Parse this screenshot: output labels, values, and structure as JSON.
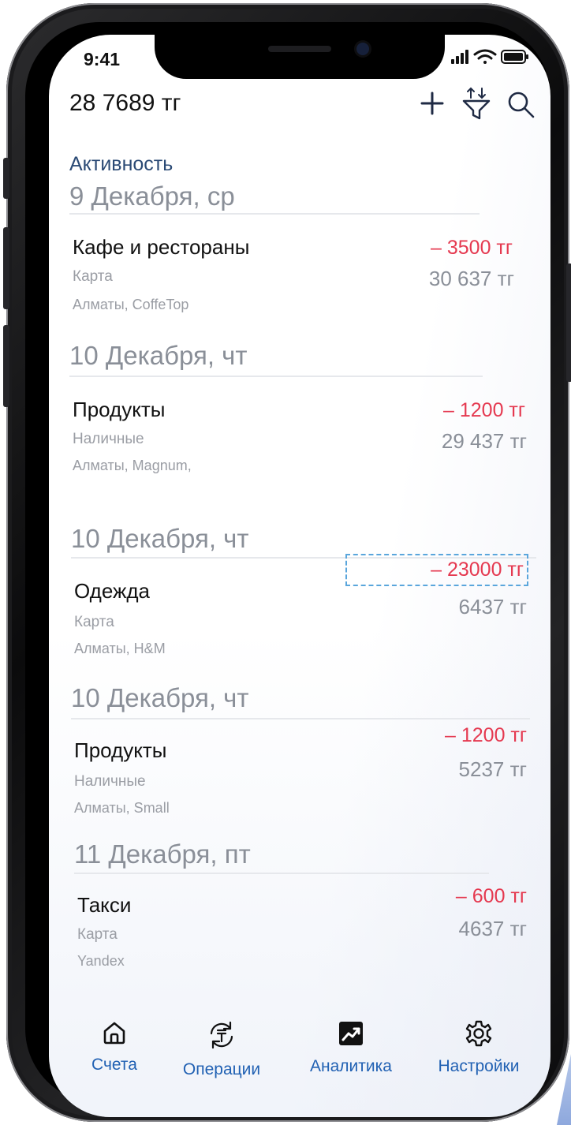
{
  "status_bar": {
    "time": "9:41"
  },
  "header": {
    "balance": "28 7689 тг"
  },
  "activity": {
    "title": "Активность",
    "groups": [
      {
        "date": "9 Декабря, ср",
        "tx": {
          "category": "Кафе и рестораны",
          "method": "Карта",
          "place": "Алматы, CoffeTop",
          "amount": "– 3500 тг",
          "balance": "30 637 тг"
        }
      },
      {
        "date": "10 Декабря, чт",
        "tx": {
          "category": "Продукты",
          "method": "Наличные",
          "place": "Алматы,  Magnum,",
          "amount": "– 1200 тг",
          "balance": "29 437 тг"
        }
      },
      {
        "date": "10 Декабря, чт",
        "tx": {
          "category": "Одежда",
          "method": "Карта",
          "place": "Алматы, H&M",
          "amount": "– 23000 тг",
          "balance": "6437 тг"
        }
      },
      {
        "date": "10 Декабря, чт",
        "tx": {
          "category": "Продукты",
          "method": "Наличные",
          "place": "Алматы, Small",
          "amount": "– 1200 тг",
          "balance": "5237 тг"
        }
      },
      {
        "date": "11 Декабря, пт",
        "tx": {
          "category": "Такси",
          "method": "Карта",
          "place": "Yandex",
          "amount": "– 600 тг",
          "balance": "4637 тг"
        }
      }
    ]
  },
  "tabbar": {
    "tabs": [
      {
        "label": "Счета",
        "icon": "home-icon"
      },
      {
        "label": "Операции",
        "icon": "exchange-tenge-icon"
      },
      {
        "label": "Аналитика",
        "icon": "analytics-chart-icon"
      },
      {
        "label": "Настройки",
        "icon": "gear-icon"
      }
    ]
  },
  "colors": {
    "accent": "#2161b3",
    "expense": "#e53950",
    "muted": "#8a8f98",
    "section": "#2b4a75"
  }
}
